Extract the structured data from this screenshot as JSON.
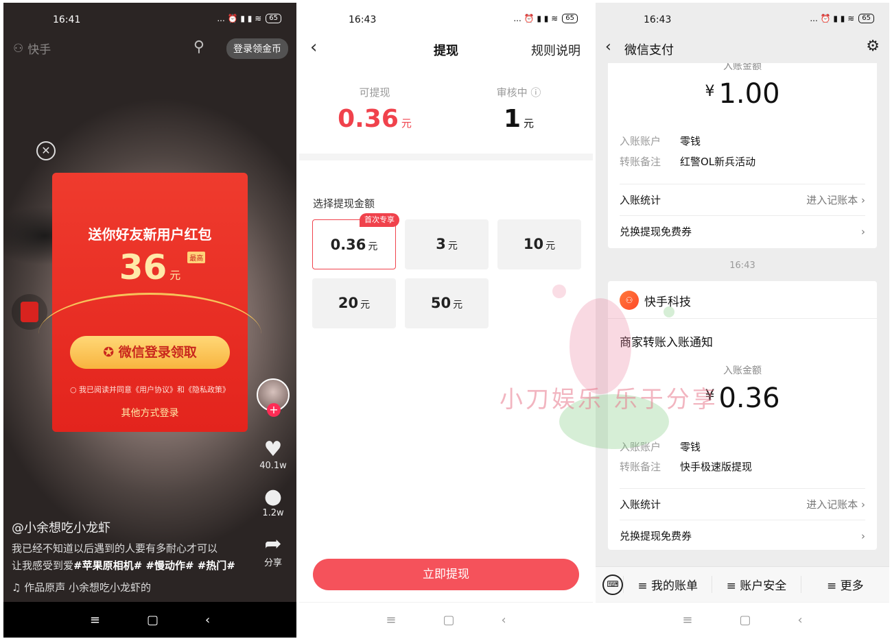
{
  "panel1": {
    "status": {
      "time": "16:41",
      "battery": "65",
      "icons": "... ⏰ ▮ ▮ ≋"
    },
    "header": {
      "app_name": "快手",
      "login_button": "登录领金币"
    },
    "red_packet": {
      "title": "送你好友新用户红包",
      "amount": "36",
      "tag": "最高",
      "unit": "元",
      "wechat_button": "微信登录领取",
      "agreement": "我已阅读并同意《用户协议》和《隐私政策》",
      "other_login": "其他方式登录"
    },
    "side": {
      "likes": "40.1w",
      "comments": "1.2w",
      "share": "分享"
    },
    "post": {
      "user": "@小余想吃小龙虾",
      "desc_line1": "我已经不知道以后遇到的人要有多耐心才可以",
      "desc_line2_plain": "让我感受到爱",
      "desc_line2_tags": "#苹果原相机# #慢动作# #热门#",
      "music": "作品原声    小余想吃小龙虾的"
    }
  },
  "panel2": {
    "status": {
      "time": "16:43",
      "battery": "65",
      "icons": "... ⏰ ▮ ▮ ≋"
    },
    "header": {
      "title": "提现",
      "rules": "规则说明"
    },
    "available": {
      "label": "可提现",
      "value": "0.36",
      "unit": "元"
    },
    "reviewing": {
      "label": "审核中",
      "value": "1",
      "unit": "元"
    },
    "choose_label": "选择提现金额",
    "amounts": [
      {
        "value": "0.36",
        "unit": "元",
        "badge": "首次专享",
        "selected": true
      },
      {
        "value": "3",
        "unit": "元"
      },
      {
        "value": "10",
        "unit": "元"
      },
      {
        "value": "20",
        "unit": "元"
      },
      {
        "value": "50",
        "unit": "元"
      }
    ],
    "withdraw_button": "立即提现"
  },
  "panel3": {
    "status": {
      "time": "16:43",
      "battery": "65",
      "icons": "... ⏰ ▮ ▮ ≋"
    },
    "header": {
      "title": "微信支付"
    },
    "card1": {
      "amount_label": "入账金额",
      "currency": "¥",
      "amount": "1.00",
      "account_label": "入账账户",
      "account_value": "零钱",
      "note_label": "转账备注",
      "note_value": "红警OL新兵活动",
      "stats_label": "入账统计",
      "stats_link": "进入记账本",
      "coupon_label": "兑换提现免费券"
    },
    "timestamp": "16:43",
    "card2": {
      "merchant": "快手科技",
      "notice": "商家转账入账通知",
      "amount_label": "入账金额",
      "currency": "¥",
      "amount": "0.36",
      "account_label": "入账账户",
      "account_value": "零钱",
      "note_label": "转账备注",
      "note_value": "快手极速版提现",
      "stats_label": "入账统计",
      "stats_link": "进入记账本",
      "coupon_label": "兑换提现免费券"
    },
    "bottom_menu": [
      "≡ 我的账单",
      "≡ 账户安全",
      "≡ 更多"
    ]
  },
  "watermark": "小刀娱乐 乐于分享"
}
